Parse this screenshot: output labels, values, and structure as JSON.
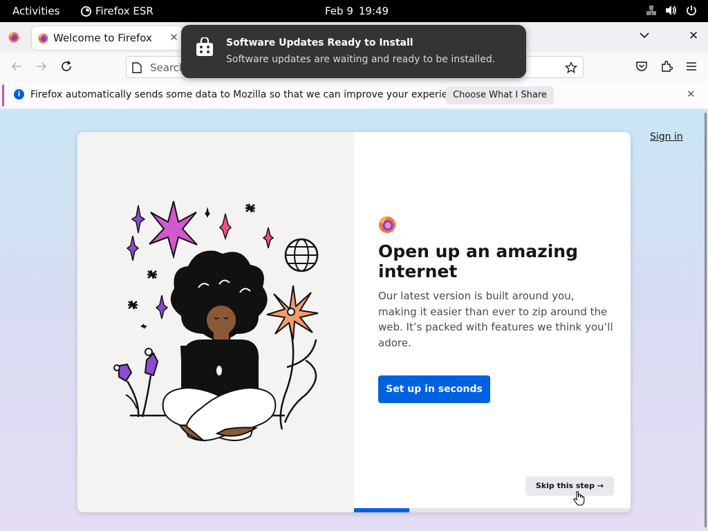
{
  "topbar": {
    "activities": "Activities",
    "app_name": "Firefox ESR",
    "date": "Feb 9",
    "time": "19:49"
  },
  "tab": {
    "title": "Welcome to Firefox"
  },
  "urlbar": {
    "placeholder": "Search"
  },
  "notification_bar": {
    "message": "Firefox automatically sends some data to Mozilla so that we can improve your experience.",
    "button_label": "Choose What I Share"
  },
  "toast": {
    "title": "Software Updates Ready to Install",
    "body": "Software updates are waiting and ready to be installed."
  },
  "page": {
    "sign_in": "Sign in",
    "heading": "Open up an amazing internet",
    "description": "Our latest version is built around you, making it easier than ever to zip around the web. It’s packed with features we think you’ll adore.",
    "cta": "Set up in seconds",
    "skip": "Skip this step →",
    "progress_fraction": 0.2
  },
  "colors": {
    "accent": "#0061e0",
    "toast_bg": "#343434",
    "topbar_bg": "#000000"
  }
}
